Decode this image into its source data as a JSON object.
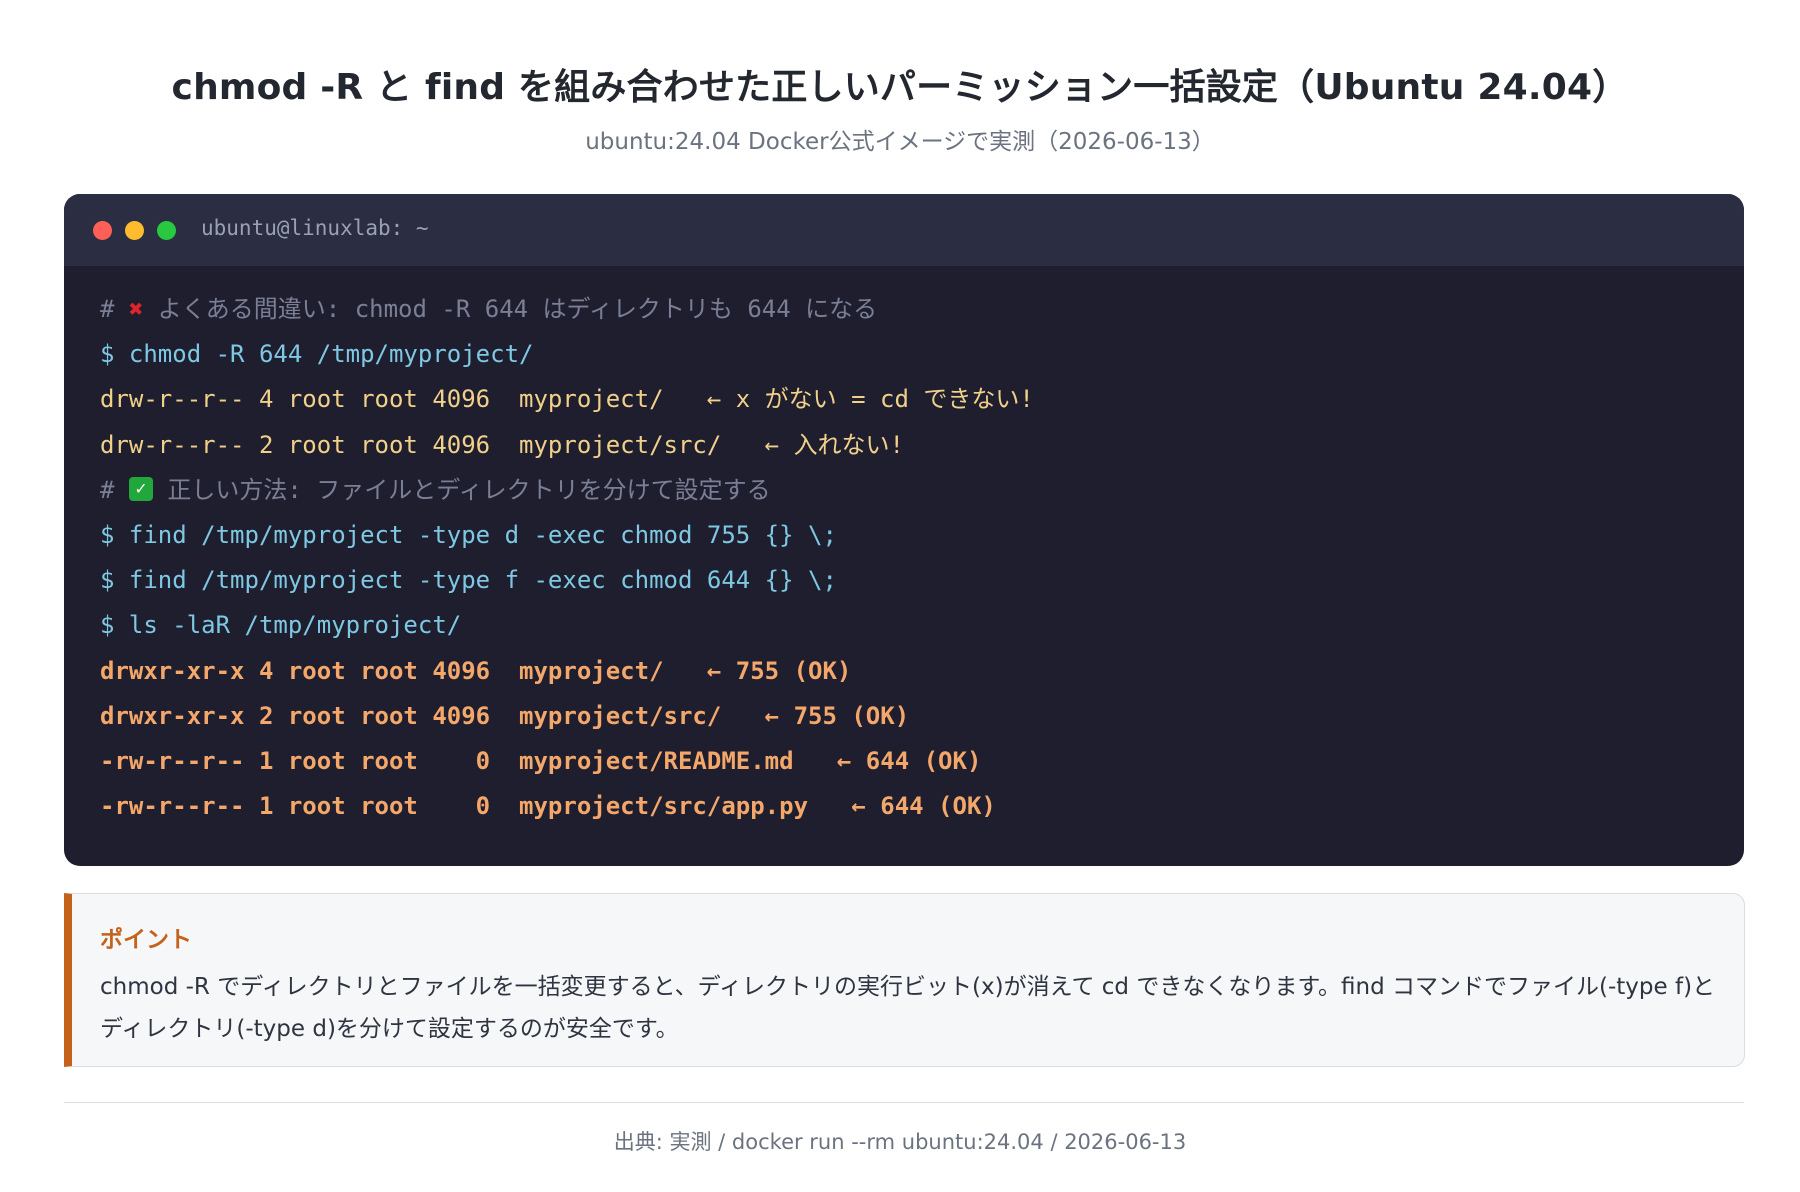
{
  "header": {
    "title": "chmod -R と find を組み合わせた正しいパーミッション一括設定（Ubuntu 24.04）",
    "subtitle": "ubuntu:24.04 Docker公式イメージで実測（2026-06-13）"
  },
  "terminal": {
    "window_title": "ubuntu@linuxlab: ~",
    "lines": [
      {
        "type": "comment",
        "prefix": "# ",
        "mark": "x",
        "text": " よくある間違い: chmod -R 644 はディレクトリも 644 になる"
      },
      {
        "type": "cmd",
        "text": "$ chmod -R 644 /tmp/myproject/"
      },
      {
        "type": "out",
        "text": "drw-r--r-- 4 root root 4096  myproject/   ← x がない = cd できない!"
      },
      {
        "type": "out",
        "text": "drw-r--r-- 2 root root 4096  myproject/src/   ← 入れない!"
      },
      {
        "type": "comment",
        "prefix": "# ",
        "mark": "check",
        "text": " 正しい方法: ファイルとディレクトリを分けて設定する"
      },
      {
        "type": "cmd",
        "text": "$ find /tmp/myproject -type d -exec chmod 755 {} \\;"
      },
      {
        "type": "cmd",
        "text": "$ find /tmp/myproject -type f -exec chmod 644 {} \\;"
      },
      {
        "type": "cmd",
        "text": "$ ls -laR /tmp/myproject/"
      },
      {
        "type": "ok",
        "text": "drwxr-xr-x 4 root root 4096  myproject/   ← 755 (OK)"
      },
      {
        "type": "ok",
        "text": "drwxr-xr-x 2 root root 4096  myproject/src/   ← 755 (OK)"
      },
      {
        "type": "ok",
        "text": "-rw-r--r-- 1 root root    0  myproject/README.md   ← 644 (OK)"
      },
      {
        "type": "ok",
        "text": "-rw-r--r-- 1 root root    0  myproject/src/app.py   ← 644 (OK)"
      }
    ]
  },
  "point": {
    "title": "ポイント",
    "text": "chmod -R でディレクトリとファイルを一括変更すると、ディレクトリの実行ビット(x)が消えて cd できなくなります。find コマンドでファイル(-type f)とディレクトリ(-type d)を分けて設定するのが安全です。"
  },
  "footer": {
    "source": "出典: 実測 / docker run --rm ubuntu:24.04 / 2026-06-13"
  },
  "colors": {
    "terminal_bg": "#1e1e2e",
    "terminal_header_bg": "#2b2d42",
    "comment": "#7b7f96",
    "command": "#7ec8e3",
    "output": "#f1d08a",
    "ok_output": "#f4a76a",
    "accent": "#c4611b"
  }
}
